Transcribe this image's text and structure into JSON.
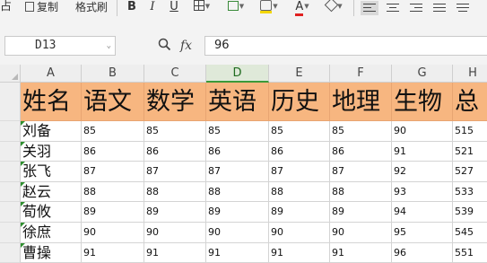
{
  "toolbar": {
    "paste_partial": "占",
    "copy_label": "复制",
    "format_painter_label": "格式刷",
    "bold_label": "B",
    "italic_label": "I",
    "underline_label": "U",
    "font_color_label": "A"
  },
  "formula_bar": {
    "cell_ref": "D13",
    "fx_label": "fx",
    "value": "96"
  },
  "grid": {
    "columns": [
      "A",
      "B",
      "C",
      "D",
      "E",
      "F",
      "G",
      "H"
    ],
    "selected_column": "D",
    "header_row": [
      "姓名",
      "语文",
      "数学",
      "英语",
      "历史",
      "地理",
      "生物",
      "总"
    ],
    "rows": [
      {
        "name": "刘备",
        "values": [
          "85",
          "85",
          "85",
          "85",
          "85",
          "90",
          "515"
        ]
      },
      {
        "name": "关羽",
        "values": [
          "86",
          "86",
          "86",
          "86",
          "86",
          "91",
          "521"
        ]
      },
      {
        "name": "张飞",
        "values": [
          "87",
          "87",
          "87",
          "87",
          "87",
          "92",
          "527"
        ]
      },
      {
        "name": "赵云",
        "values": [
          "88",
          "88",
          "88",
          "88",
          "88",
          "93",
          "533"
        ]
      },
      {
        "name": "荀攸",
        "values": [
          "89",
          "89",
          "89",
          "89",
          "89",
          "94",
          "539"
        ]
      },
      {
        "name": "徐庶",
        "values": [
          "90",
          "90",
          "90",
          "90",
          "90",
          "95",
          "545"
        ]
      },
      {
        "name": "曹操",
        "values": [
          "91",
          "91",
          "91",
          "91",
          "91",
          "96",
          "551"
        ]
      }
    ]
  },
  "colors": {
    "header_fill": "#f7b680",
    "selected_column": "#3a9a3a"
  }
}
